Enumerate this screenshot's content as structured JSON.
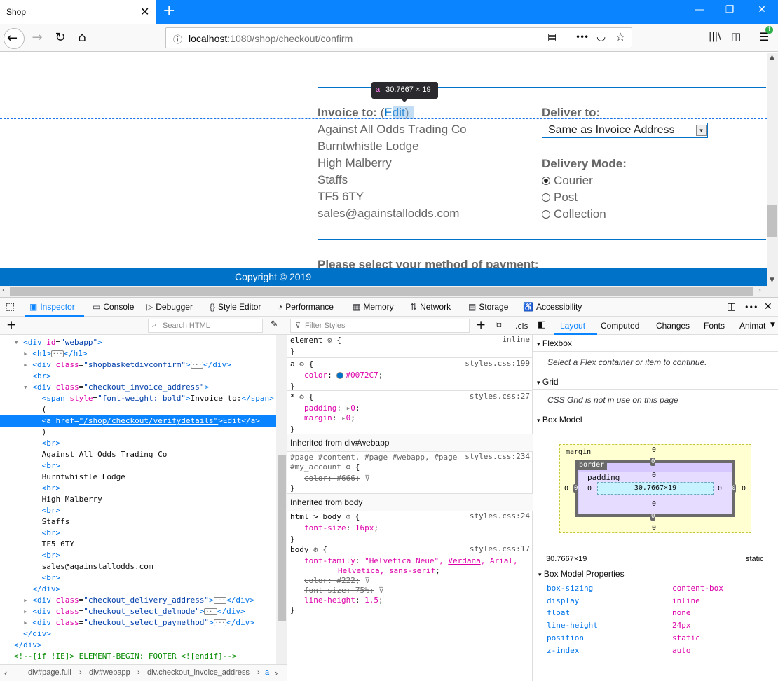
{
  "window": {
    "tab_title": "Shop",
    "tab_close": "✕",
    "new_tab": "+",
    "minimize": "—",
    "restore": "❐",
    "close": "✕"
  },
  "nav": {
    "back": "←",
    "forward": "→",
    "reload": "↻",
    "home": "⌂",
    "url_host": "localhost",
    "url_rest": ":1080/shop/checkout/confirm",
    "reader": "▤",
    "more": "•••",
    "pocket": "◡",
    "bookmark": "☆",
    "library": "|||\\",
    "sidebar": "◫",
    "menu": "☰"
  },
  "page": {
    "invoice_label": "Invoice to:",
    "paren_open": "(",
    "edit_link": "Edit",
    "paren_close": ")",
    "invoice_lines": [
      "Against All Odds Trading Co",
      "Burntwhistle Lodge",
      "High Malberry",
      "Staffs",
      "TF5 6TY",
      "sales@againstallodds.com"
    ],
    "deliver_label": "Deliver to:",
    "deliver_select": "Same as Invoice Address",
    "deliver_select_arrow": "▾",
    "delivery_mode_label": "Delivery Mode:",
    "delivery_modes": [
      {
        "label": "Courier",
        "checked": true
      },
      {
        "label": "Post",
        "checked": false
      },
      {
        "label": "Collection",
        "checked": false
      }
    ],
    "payment_heading": "Please select your method of payment:",
    "footer": "Copyright © 2019",
    "tooltip_tag": "a",
    "tooltip_size": "30.7667 × 19"
  },
  "devtools": {
    "tabs": {
      "inspector": "Inspector",
      "console": "Console",
      "debugger": "Debugger",
      "style_editor": "Style Editor",
      "performance": "Performance",
      "memory": "Memory",
      "network": "Network",
      "storage": "Storage",
      "accessibility": "Accessibility"
    },
    "search_html_placeholder": "Search HTML",
    "filter_styles_placeholder": "Filter Styles",
    "cls_label": ".cls",
    "breadcrumbs": [
      "div#page.full",
      "div#webapp",
      "div.checkout_invoice_address",
      "a"
    ],
    "layout_tabs": [
      "Layout",
      "Computed",
      "Changes",
      "Fonts",
      "Animat"
    ],
    "flexbox_label": "Flexbox",
    "flexbox_note": "Select a Flex container or item to continue.",
    "grid_label": "Grid",
    "grid_note": "CSS Grid is not in use on this page",
    "box_model_label": "Box Model",
    "bm": {
      "margin": "margin",
      "border": "border",
      "padding": "padding",
      "content": "30.7667×19",
      "zero": "0"
    },
    "bm_size": "30.7667×19",
    "bm_position": "static",
    "bm_props_label": "Box Model Properties",
    "bm_props": [
      {
        "name": "box-sizing",
        "value": "content-box"
      },
      {
        "name": "display",
        "value": "inline"
      },
      {
        "name": "float",
        "value": "none"
      },
      {
        "name": "line-height",
        "value": "24px"
      },
      {
        "name": "position",
        "value": "static"
      },
      {
        "name": "z-index",
        "value": "auto"
      }
    ],
    "rules": {
      "element_sel": "element",
      "element_src": "inline",
      "a_sel": "a",
      "a_src": "styles.css:199",
      "a_color_prop": "color",
      "a_color_val": "#0072C7",
      "star_sel": "*",
      "star_src": "styles.css:27",
      "padding_prop": "padding",
      "margin_prop": "margin",
      "zero_val": "0",
      "inherited_webapp": "Inherited from div#webapp",
      "page_sel_1": "#page #content, #page #webapp, #page",
      "page_sel_2": "#my_account",
      "page_src": "styles.css:234",
      "page_color_prop": "color",
      "page_color_val": "#666",
      "inherited_body": "Inherited from body",
      "htmlbody_sel": "html > body",
      "htmlbody_src": "styles.css:24",
      "fontsize_prop": "font-size",
      "fontsize_val": "16px",
      "body_sel": "body",
      "body_src": "styles.css:17",
      "fontfamily_prop": "font-family",
      "fontfamily_val1": "\"Helvetica Neue\", ",
      "fontfamily_verdana": "Verdana",
      "fontfamily_val2": ", Arial,",
      "fontfamily_val3": "Helvetica, sans-serif",
      "body_color_prop": "color",
      "body_color_val": "#222",
      "body_fontsize_prop": "font-size",
      "body_fontsize_val": "75%",
      "lineheight_prop": "line-height",
      "lineheight_val": "1.5"
    }
  },
  "colors": {
    "accent": "#0a84ff",
    "site_blue": "#0072c7",
    "page_text": "#666666"
  }
}
